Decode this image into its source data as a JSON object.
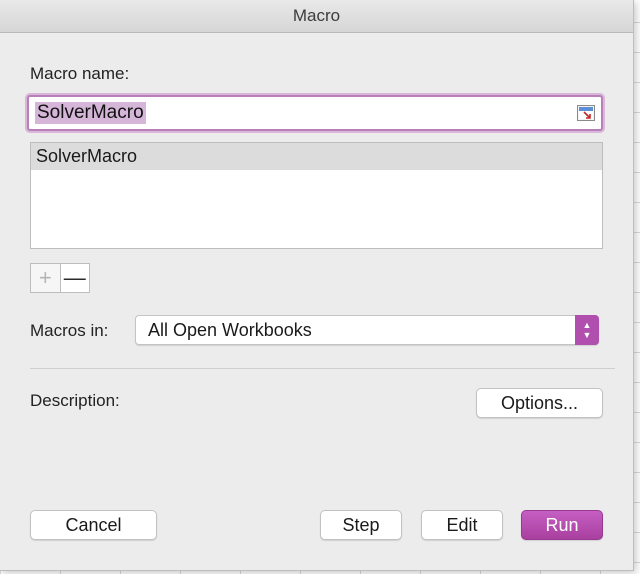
{
  "window": {
    "title": "Macro"
  },
  "macro_name": {
    "label": "Macro name:",
    "value": "SolverMacro",
    "ref_icon": "collapse-dialog-icon"
  },
  "macro_list": {
    "items": [
      "SolverMacro"
    ],
    "selected": "SolverMacro"
  },
  "list_controls": {
    "add": "+",
    "remove": "—"
  },
  "macros_in": {
    "label": "Macros in:",
    "value": "All Open Workbooks"
  },
  "description": {
    "label": "Description:"
  },
  "buttons": {
    "options": "Options...",
    "cancel": "Cancel",
    "step": "Step",
    "edit": "Edit",
    "run": "Run"
  },
  "colors": {
    "accent": "#b04fae",
    "focus_ring": "#b97fb9",
    "selection_highlight": "#d6b6d8",
    "dialog_background": "#ececec"
  }
}
